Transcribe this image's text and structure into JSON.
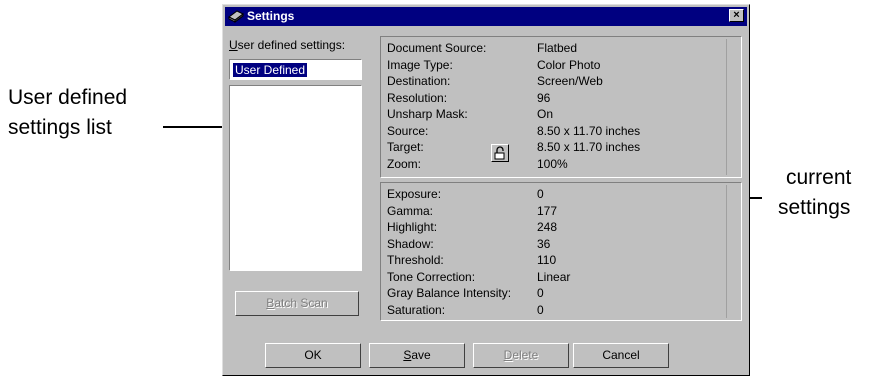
{
  "annotations": {
    "left_line1": "User defined",
    "left_line2": "settings list",
    "right_line1": "current",
    "right_line2": "settings"
  },
  "dialog": {
    "title": "Settings",
    "close_glyph": "×",
    "icons": [
      "scanner-icon",
      "close-icon",
      "lock-icon"
    ]
  },
  "user_defined": {
    "label_u": "U",
    "label_rest": "ser defined settings:",
    "value": "User Defined",
    "items": []
  },
  "buttons": {
    "batch_scan_u": "B",
    "batch_scan_rest": "atch Scan",
    "ok": "OK",
    "save_u": "S",
    "save_rest": "ave",
    "delete_u": "D",
    "delete_rest": "elete",
    "cancel": "Cancel"
  },
  "current_settings": {
    "top": [
      {
        "label": "Document Source:",
        "value": "Flatbed"
      },
      {
        "label": "Image Type:",
        "value": "Color Photo"
      },
      {
        "label": "Destination:",
        "value": "Screen/Web"
      },
      {
        "label": "Resolution:",
        "value": "96"
      },
      {
        "label": "Unsharp Mask:",
        "value": "On"
      },
      {
        "label": "Source:",
        "value": "8.50 x 11.70 inches"
      },
      {
        "label": "Target:",
        "value": "8.50 x 11.70 inches"
      },
      {
        "label": "Zoom:",
        "value": "100%"
      }
    ],
    "bottom": [
      {
        "label": "Exposure:",
        "value": "0"
      },
      {
        "label": "Gamma:",
        "value": "177"
      },
      {
        "label": "Highlight:",
        "value": "248"
      },
      {
        "label": "Shadow:",
        "value": "36"
      },
      {
        "label": "Threshold:",
        "value": "110"
      },
      {
        "label": "Tone Correction:",
        "value": "Linear"
      },
      {
        "label": "Gray Balance Intensity:",
        "value": "0"
      },
      {
        "label": "Saturation:",
        "value": "0"
      }
    ]
  }
}
